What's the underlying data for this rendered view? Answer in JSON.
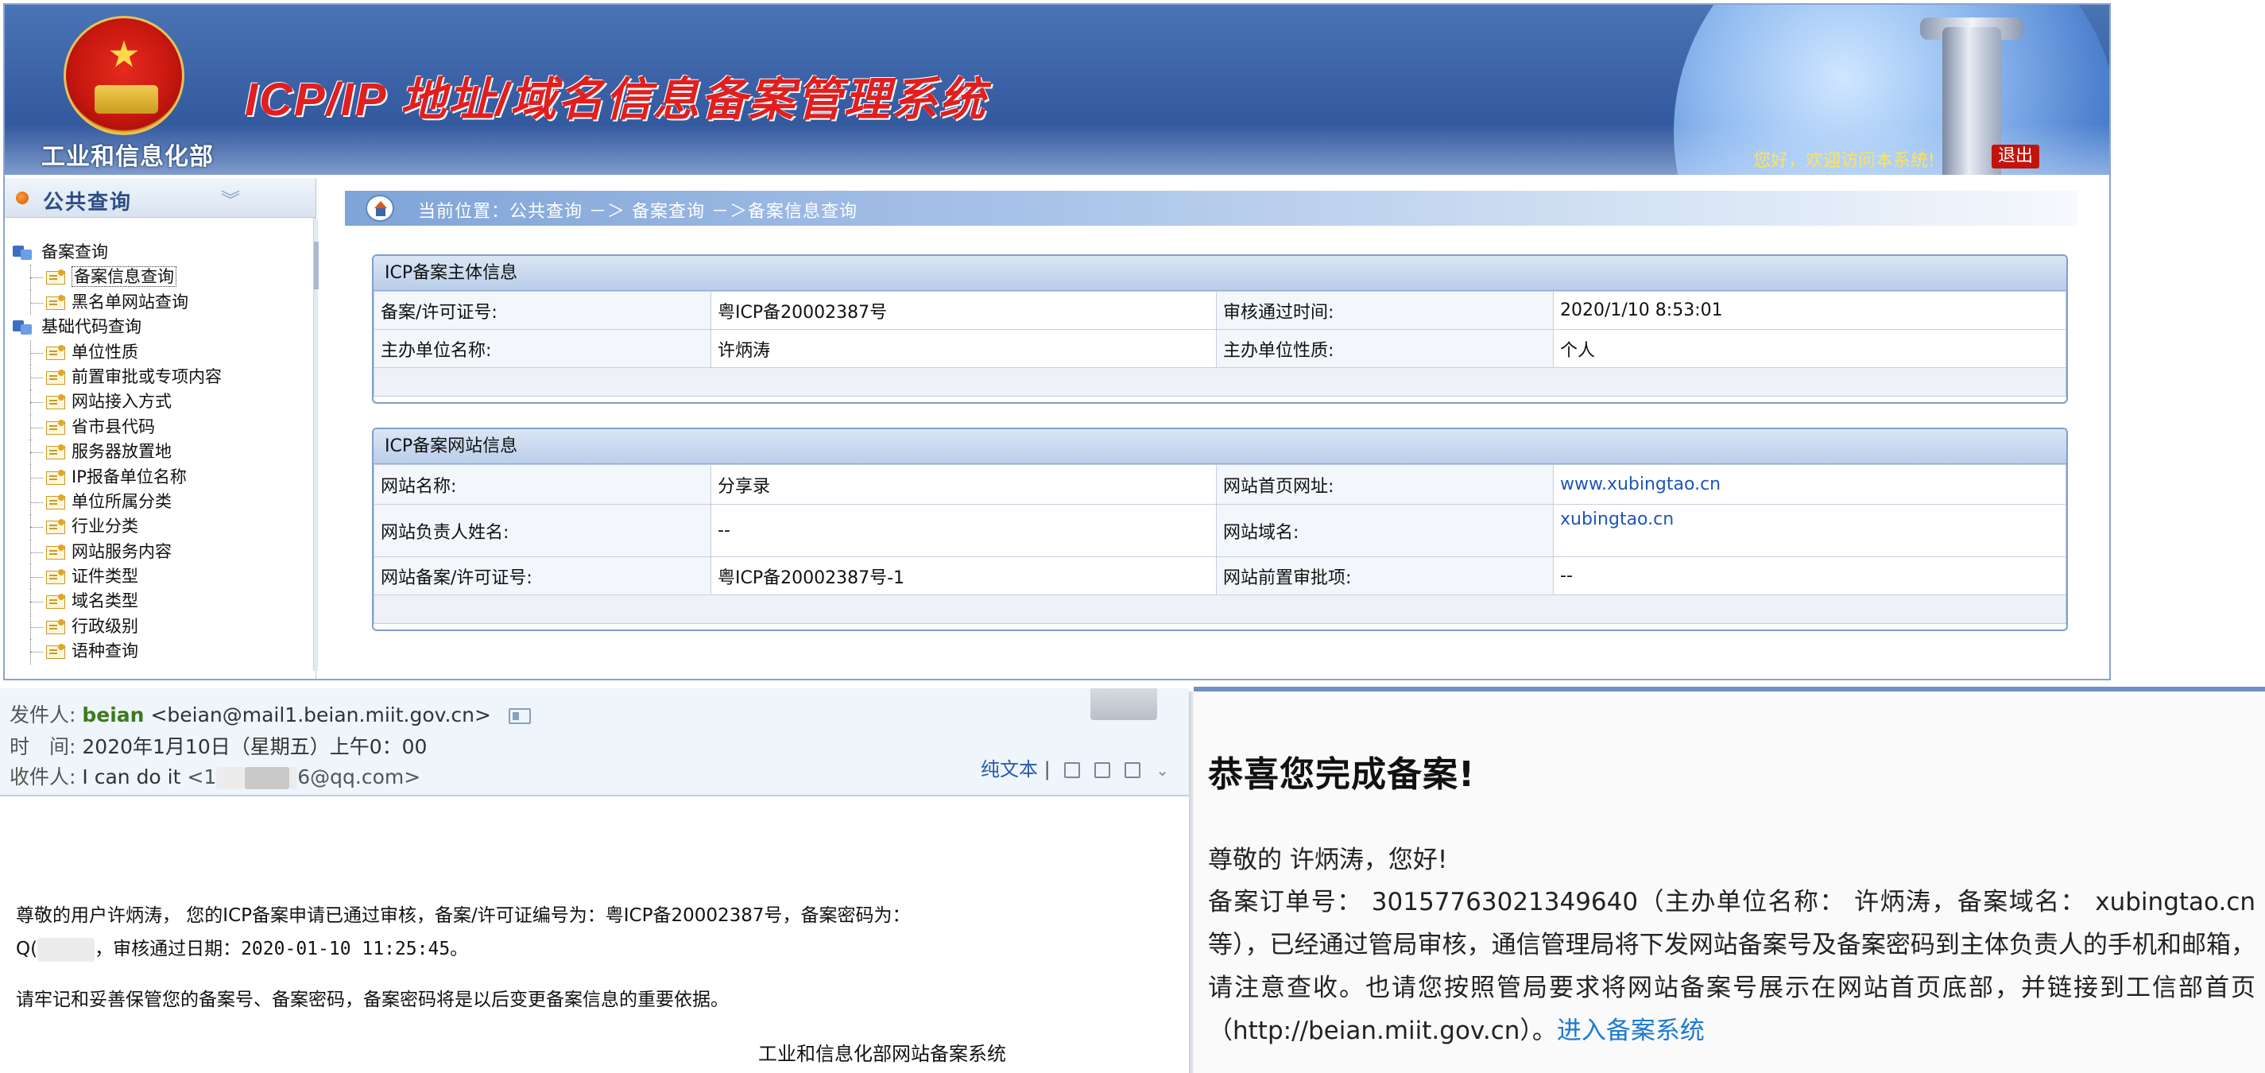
{
  "icp": {
    "ministry": "工业和信息化部",
    "title": "ICP/IP 地址/域名信息备案管理系统",
    "greeting": "您好，欢迎访问本系统!",
    "logout": "退出",
    "sidebar": {
      "title": "公共查询",
      "groups": [
        {
          "label": "备案查询",
          "items": [
            "备案信息查询",
            "黑名单网站查询"
          ]
        },
        {
          "label": "基础代码查询",
          "items": [
            "单位性质",
            "前置审批或专项内容",
            "网站接入方式",
            "省市县代码",
            "服务器放置地",
            "IP报备单位名称",
            "单位所属分类",
            "行业分类",
            "网站服务内容",
            "证件类型",
            "域名类型",
            "行政级别",
            "语种查询"
          ]
        }
      ]
    },
    "breadcrumb": "当前位置：公共查询 －＞ 备案查询 －＞备案信息查询",
    "subject": {
      "heading": "ICP备案主体信息",
      "rows": [
        [
          "备案/许可证号:",
          "粤ICP备20002387号",
          "审核通过时间:",
          "2020/1/10 8:53:01"
        ],
        [
          "主办单位名称:",
          "许炳涛",
          "主办单位性质:",
          "个人"
        ]
      ]
    },
    "website": {
      "heading": "ICP备案网站信息",
      "rows": [
        [
          "网站名称:",
          "分享录",
          "网站首页网址:",
          "www.xubingtao.cn"
        ],
        [
          "网站负责人姓名:",
          "--",
          "网站域名:",
          "xubingtao.cn"
        ],
        [
          "网站备案/许可证号:",
          "粤ICP备20002387号-1",
          "网站前置审批项:",
          "--"
        ]
      ]
    }
  },
  "email": {
    "from_label": "发件人:",
    "from_name": "beian",
    "from_addr": "<beian@mail1.beian.miit.gov.cn>",
    "time_label": "时　间:",
    "time_value": "2020年1月10日（星期五）上午0：00",
    "to_label": "收件人:",
    "to_name": "I can do it",
    "to_prefix": "<1",
    "to_suffix": "6@qq.com>",
    "plain_text": "纯文本",
    "body_line1": "尊敬的用户许炳涛，  您的ICP备案申请已通过审核，备案/许可证编号为：粤ICP备20002387号，备案密码为：",
    "body_line2_prefix": "Q(",
    "body_line2_rest": "，审核通过日期：2020-01-10 11:25:45。",
    "body_line3": "请牢记和妥善保管您的备案号、备案密码，备案密码将是以后变更备案信息的重要依据。",
    "signature": "工业和信息化部网站备案系统"
  },
  "congrats": {
    "title": "恭喜您完成备案!",
    "greeting": "尊敬的 许炳涛，您好!",
    "para": "备案订单号： 30157763021349640（主办单位名称： 许炳涛，备案域名： xubingtao.cn等），已经通过管局审核，通信管理局将下发网站备案号及备案密码到主体负责人的手机和邮箱，请注意查收。也请您按照管局要求将网站备案号展示在网站首页底部，并链接到工信部首页（",
    "url": "http://beian.miit.gov.cn",
    "para_end": "）。",
    "link": "进入备案系统"
  },
  "colors": {
    "header_blue": "#3b62a6",
    "title_red": "#e11f1f",
    "link_blue": "#1e56b8",
    "sender_green": "#3d7a1d"
  }
}
